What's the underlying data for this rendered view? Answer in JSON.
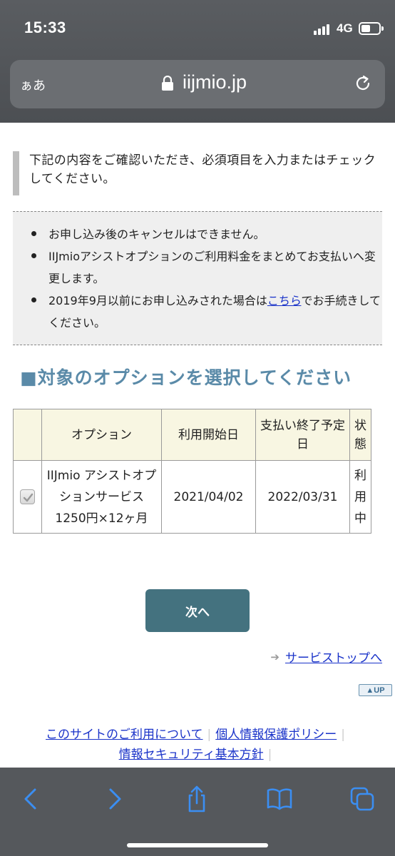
{
  "status_bar": {
    "time": "15:33",
    "network": "4G"
  },
  "browser": {
    "text_size_label": "ぁあ",
    "url": "iijmio.jp"
  },
  "notice": {
    "text": "下記の内容をご確認いただき、必須項目を入力またはチェックしてください。"
  },
  "cautions": {
    "item1": "お申し込み後のキャンセルはできません。",
    "item2": "IIJmioアシストオプションのご利用料金をまとめてお支払いへ変更します。",
    "item3_before": "2019年9月以前にお申し込みされた場合は",
    "item3_link": "こちら",
    "item3_after": "でお手続きしてください。"
  },
  "section_title": "■対象のオプションを選択してください",
  "table": {
    "headers": {
      "option": "オプション",
      "start_date": "利用開始日",
      "end_date": "支払い終了予定日",
      "status": "状態"
    },
    "rows": [
      {
        "checked": true,
        "option": "IIJmio アシストオプションサービス 1250円×12ヶ月",
        "start_date": "2021/04/02",
        "end_date": "2022/03/31",
        "status": "利用中"
      }
    ]
  },
  "next_button": "次へ",
  "service_top_link": "サービストップへ",
  "up_badge": "▲UP",
  "footer": {
    "link_terms": "このサイトのご利用について",
    "link_privacy": "個人情報保護ポリシー",
    "link_security": "情報セキュリティ基本方針"
  }
}
